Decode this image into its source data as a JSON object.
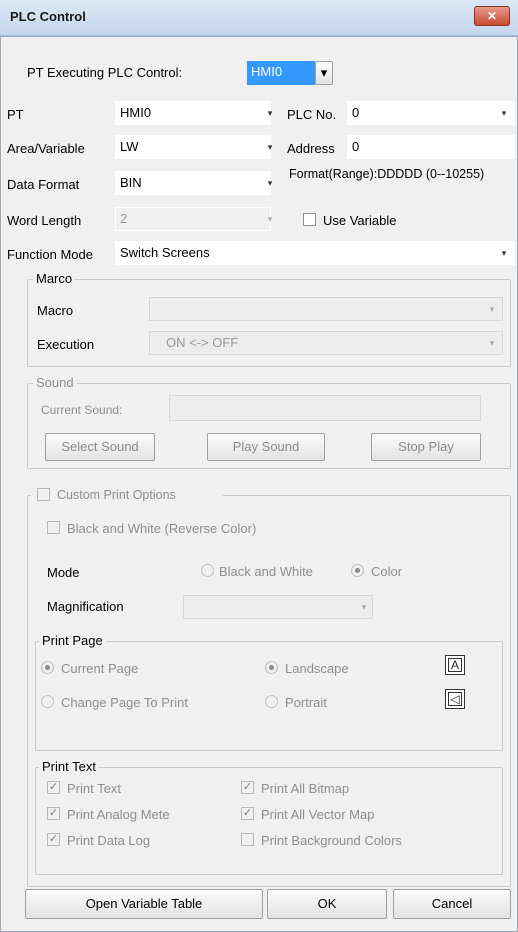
{
  "window": {
    "title": "PLC Control",
    "close_label": "✕"
  },
  "pt_executing": {
    "label": "PT Executing PLC Control:",
    "value": "HMI0"
  },
  "pt": {
    "label": "PT",
    "value": "HMI0"
  },
  "plc_no": {
    "label": "PLC No.",
    "value": "0"
  },
  "area": {
    "label": "Area/Variable",
    "value": "LW"
  },
  "address": {
    "label": "Address",
    "value": "0"
  },
  "data_format": {
    "label": "Data Format",
    "value": "BIN",
    "format_text": "Format(Range):DDDDD (0--10255)"
  },
  "word_length": {
    "label": "Word Length",
    "value": "2"
  },
  "use_variable": {
    "label": "Use Variable",
    "checked": false
  },
  "function_mode": {
    "label": "Function Mode",
    "value": "Switch Screens"
  },
  "macro_group": {
    "title": "Marco",
    "macro_label": "Macro",
    "macro_value": "",
    "execution_label": "Execution",
    "execution_value": "ON <-> OFF"
  },
  "sound_group": {
    "title": "Sound",
    "current_sound_label": "Current Sound:",
    "current_sound_value": "",
    "select_label": "Select Sound",
    "play_label": "Play Sound",
    "stop_label": "Stop Play"
  },
  "print_group": {
    "custom_label": "Custom Print Options",
    "bw_reverse_label": "Black and White (Reverse Color)",
    "mode_label": "Mode",
    "mode_bw_label": "Black and White",
    "mode_color_label": "Color",
    "mode_selected": "Color",
    "magnification_label": "Magnification",
    "magnification_value": "",
    "print_page": {
      "title": "Print Page",
      "current_page_label": "Current Page",
      "change_page_label": "Change Page To Print",
      "landscape_label": "Landscape",
      "portrait_label": "Portrait",
      "landscape_icon_text": "A",
      "portrait_icon_text": "◁"
    },
    "print_text": {
      "title": "Print Text",
      "items": [
        {
          "label": "Print Text",
          "checked": true
        },
        {
          "label": "Print Analog Mete",
          "checked": true
        },
        {
          "label": "Print Data Log",
          "checked": true
        },
        {
          "label": "Print All Bitmap",
          "checked": true
        },
        {
          "label": "Print All Vector Map",
          "checked": true
        },
        {
          "label": "Print Background Colors",
          "checked": false
        }
      ]
    }
  },
  "footer": {
    "open_variable_table_label": "Open Variable Table",
    "ok_label": "OK",
    "cancel_label": "Cancel"
  },
  "icons": {
    "dropdown": "▾",
    "check": "✓"
  }
}
